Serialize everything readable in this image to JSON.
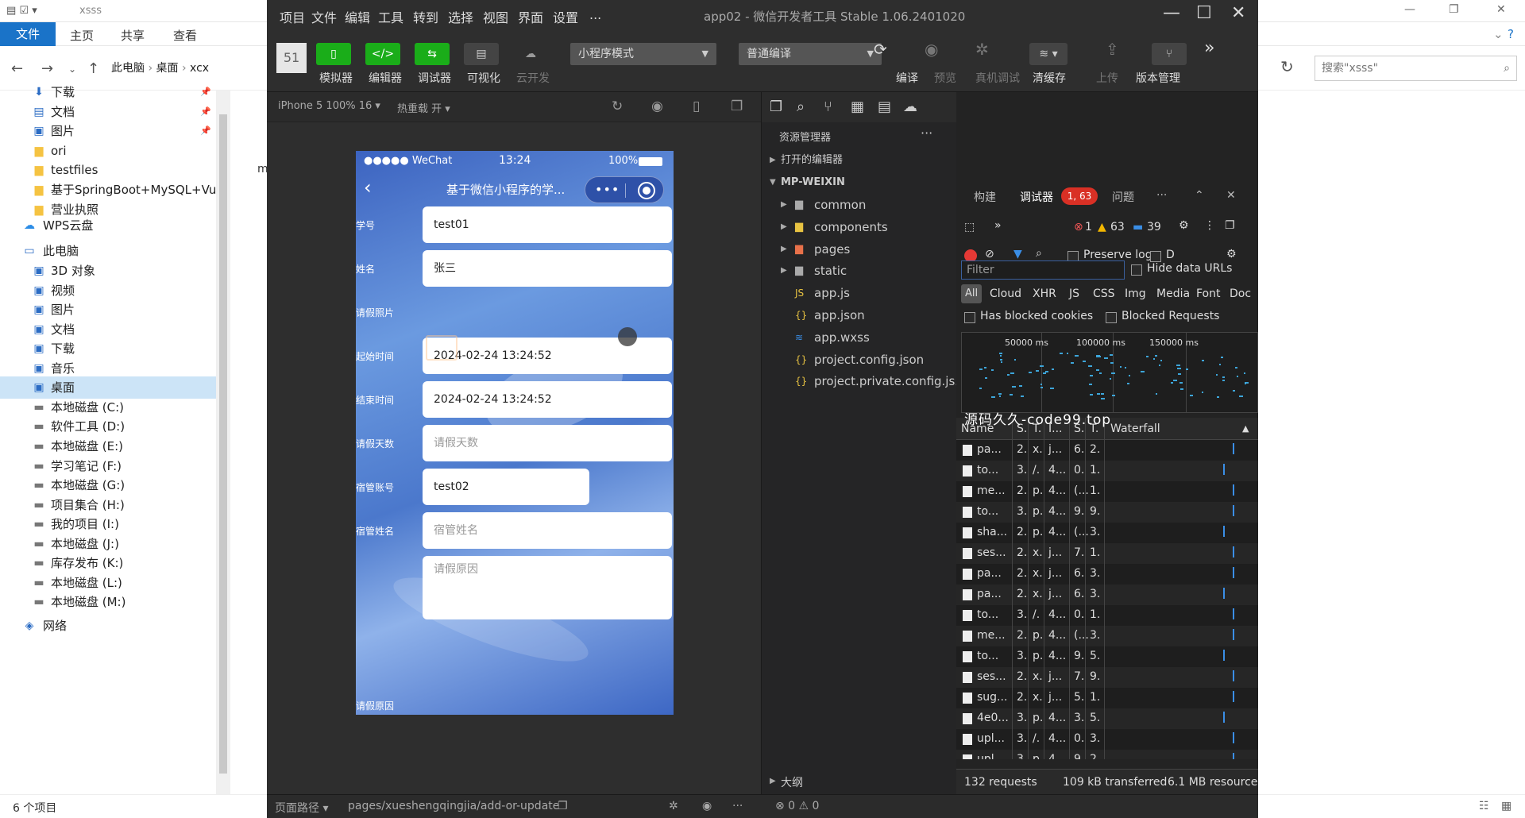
{
  "explorer": {
    "folder_name": "xsss",
    "ribbon_tabs": [
      "文件",
      "主页",
      "共享",
      "查看"
    ],
    "breadcrumb": [
      "此电脑",
      "桌面",
      "xcx"
    ],
    "search_placeholder": "搜索\"xsss\"",
    "mid_text": "m",
    "status_count": "6 个项目",
    "sidebar_quick": [
      {
        "label": "下载",
        "icon": "download-icon"
      },
      {
        "label": "文档",
        "icon": "document-icon"
      },
      {
        "label": "图片",
        "icon": "picture-icon"
      },
      {
        "label": "ori",
        "icon": "folder-icon"
      },
      {
        "label": "testfiles",
        "icon": "folder-icon"
      },
      {
        "label": "基于SpringBoot+MySQL+Vu",
        "icon": "folder-icon"
      },
      {
        "label": "营业执照",
        "icon": "folder-icon"
      }
    ],
    "sidebar_wps": "WPS云盘",
    "sidebar_pc": "此电脑",
    "sidebar_pc_items": [
      "3D 对象",
      "视频",
      "图片",
      "文档",
      "下载",
      "音乐",
      "桌面",
      "本地磁盘 (C:)",
      "软件工具 (D:)",
      "本地磁盘 (E:)",
      "学习笔记 (F:)",
      "本地磁盘 (G:)",
      "项目集合 (H:)",
      "我的项目 (I:)",
      "本地磁盘 (J:)",
      "库存发布 (K:)",
      "本地磁盘 (L:)",
      "本地磁盘 (M:)"
    ],
    "sidebar_network": "网络"
  },
  "ide": {
    "title": "app02 - 微信开发者工具 Stable 1.06.2401020",
    "menus": [
      "项目",
      "文件",
      "编辑",
      "工具",
      "转到",
      "选择",
      "视图",
      "界面",
      "设置",
      "..."
    ],
    "avatar_text": "51",
    "toolbar_left": [
      "模拟器",
      "编辑器",
      "调试器",
      "可视化",
      "云开发"
    ],
    "mode_select": "小程序模式",
    "compile_select": "普通编译",
    "toolbar_right": [
      "编译",
      "预览",
      "真机调试",
      "清缓存",
      "上传",
      "版本管理"
    ],
    "simulator": {
      "device": "iPhone 5 100% 16 ▾",
      "hot_reload": "热重载 开 ▾"
    },
    "status_path_label": "页面路径 ▾",
    "status_path": "pages/xueshengqingjia/add-or-update",
    "status_errors": "⊗ 0 ⚠ 0"
  },
  "phone": {
    "carrier": "●●●●● WeChat",
    "time": "13:24",
    "battery": "100%",
    "nav_title": "基于微信小程序的学...",
    "form": [
      {
        "label": "学号",
        "value": "test01",
        "placeholder": false
      },
      {
        "label": "姓名",
        "value": "张三",
        "placeholder": false
      },
      {
        "label": "请假照片",
        "value": "",
        "placeholder": false
      },
      {
        "label": "起始时间",
        "value": "2024-02-24 13:24:52",
        "placeholder": false
      },
      {
        "label": "结束时间",
        "value": "2024-02-24 13:24:52",
        "placeholder": false
      },
      {
        "label": "请假天数",
        "value": "请假天数",
        "placeholder": true
      },
      {
        "label": "宿管账号",
        "value": "test02",
        "placeholder": false
      },
      {
        "label": "宿管姓名",
        "value": "宿管姓名",
        "placeholder": true
      },
      {
        "label": "请假原因",
        "value": "请假原因",
        "placeholder": true
      }
    ]
  },
  "file_panel": {
    "title": "资源管理器",
    "open_editors": "打开的编辑器",
    "root": "MP-WEIXIN",
    "folders": [
      "common",
      "components",
      "pages",
      "static"
    ],
    "files": [
      {
        "name": "app.js",
        "icon": "JS"
      },
      {
        "name": "app.json",
        "icon": "{}"
      },
      {
        "name": "app.wxss",
        "icon": "≋"
      },
      {
        "name": "project.config.json",
        "icon": "{}"
      },
      {
        "name": "project.private.config.js...",
        "icon": "{}"
      }
    ],
    "outline": "大纲"
  },
  "devtools": {
    "tabs": [
      "构建",
      "调试器",
      "问题"
    ],
    "badge": "1, 63",
    "counts": {
      "errors": "1",
      "warnings": "63",
      "info": "39"
    },
    "preserve_log": "Preserve log",
    "disable": "D",
    "filter_placeholder": "Filter",
    "hide_data_urls": "Hide data URLs",
    "types": [
      "All",
      "Cloud",
      "XHR",
      "JS",
      "CSS",
      "Img",
      "Media",
      "Font",
      "Doc"
    ],
    "has_blocked_cookies": "Has blocked cookies",
    "blocked_requests": "Blocked Requests",
    "timeline_ticks": [
      "50000 ms",
      "100000 ms",
      "150000 ms"
    ],
    "columns": [
      "Name",
      "S.",
      "T.",
      "I...",
      "S.",
      "T.",
      "Waterfall"
    ],
    "rows": [
      [
        "pa...",
        "2.",
        "x.",
        "j...",
        "6.",
        "2."
      ],
      [
        "to...",
        "3.",
        "/.",
        "4...",
        "0.",
        "1."
      ],
      [
        "me...",
        "2.",
        "p.",
        "4...",
        "(...",
        "1."
      ],
      [
        "to...",
        "3.",
        "p.",
        "4...",
        "9.",
        "9."
      ],
      [
        "sha...",
        "2.",
        "p.",
        "4...",
        "(...",
        "3."
      ],
      [
        "ses...",
        "2.",
        "x.",
        "j...",
        "7.",
        "1."
      ],
      [
        "pa...",
        "2.",
        "x.",
        "j...",
        "6.",
        "3."
      ],
      [
        "pa...",
        "2.",
        "x.",
        "j...",
        "6.",
        "3."
      ],
      [
        "to...",
        "3.",
        "/.",
        "4...",
        "0.",
        "1."
      ],
      [
        "me...",
        "2.",
        "p.",
        "4...",
        "(...",
        "3."
      ],
      [
        "to...",
        "3.",
        "p.",
        "4...",
        "9.",
        "5."
      ],
      [
        "ses...",
        "2.",
        "x.",
        "j...",
        "7.",
        "9."
      ],
      [
        "sug...",
        "2.",
        "x.",
        "j...",
        "5.",
        "1."
      ],
      [
        "4e0...",
        "3.",
        "p.",
        "4...",
        "3.",
        "5."
      ],
      [
        "upl...",
        "3.",
        "/.",
        "4...",
        "0.",
        "3."
      ],
      [
        "upl...",
        "3.",
        "p.",
        "4...",
        "9.",
        "2."
      ]
    ],
    "footer": [
      "132 requests",
      "109 kB transferred",
      "6.1 MB resource"
    ]
  },
  "watermark": "源码久久-code99.top",
  "colors": {
    "accent_green": "#1aad19",
    "error_red": "#d93025",
    "explorer_blue": "#1a73c8"
  }
}
